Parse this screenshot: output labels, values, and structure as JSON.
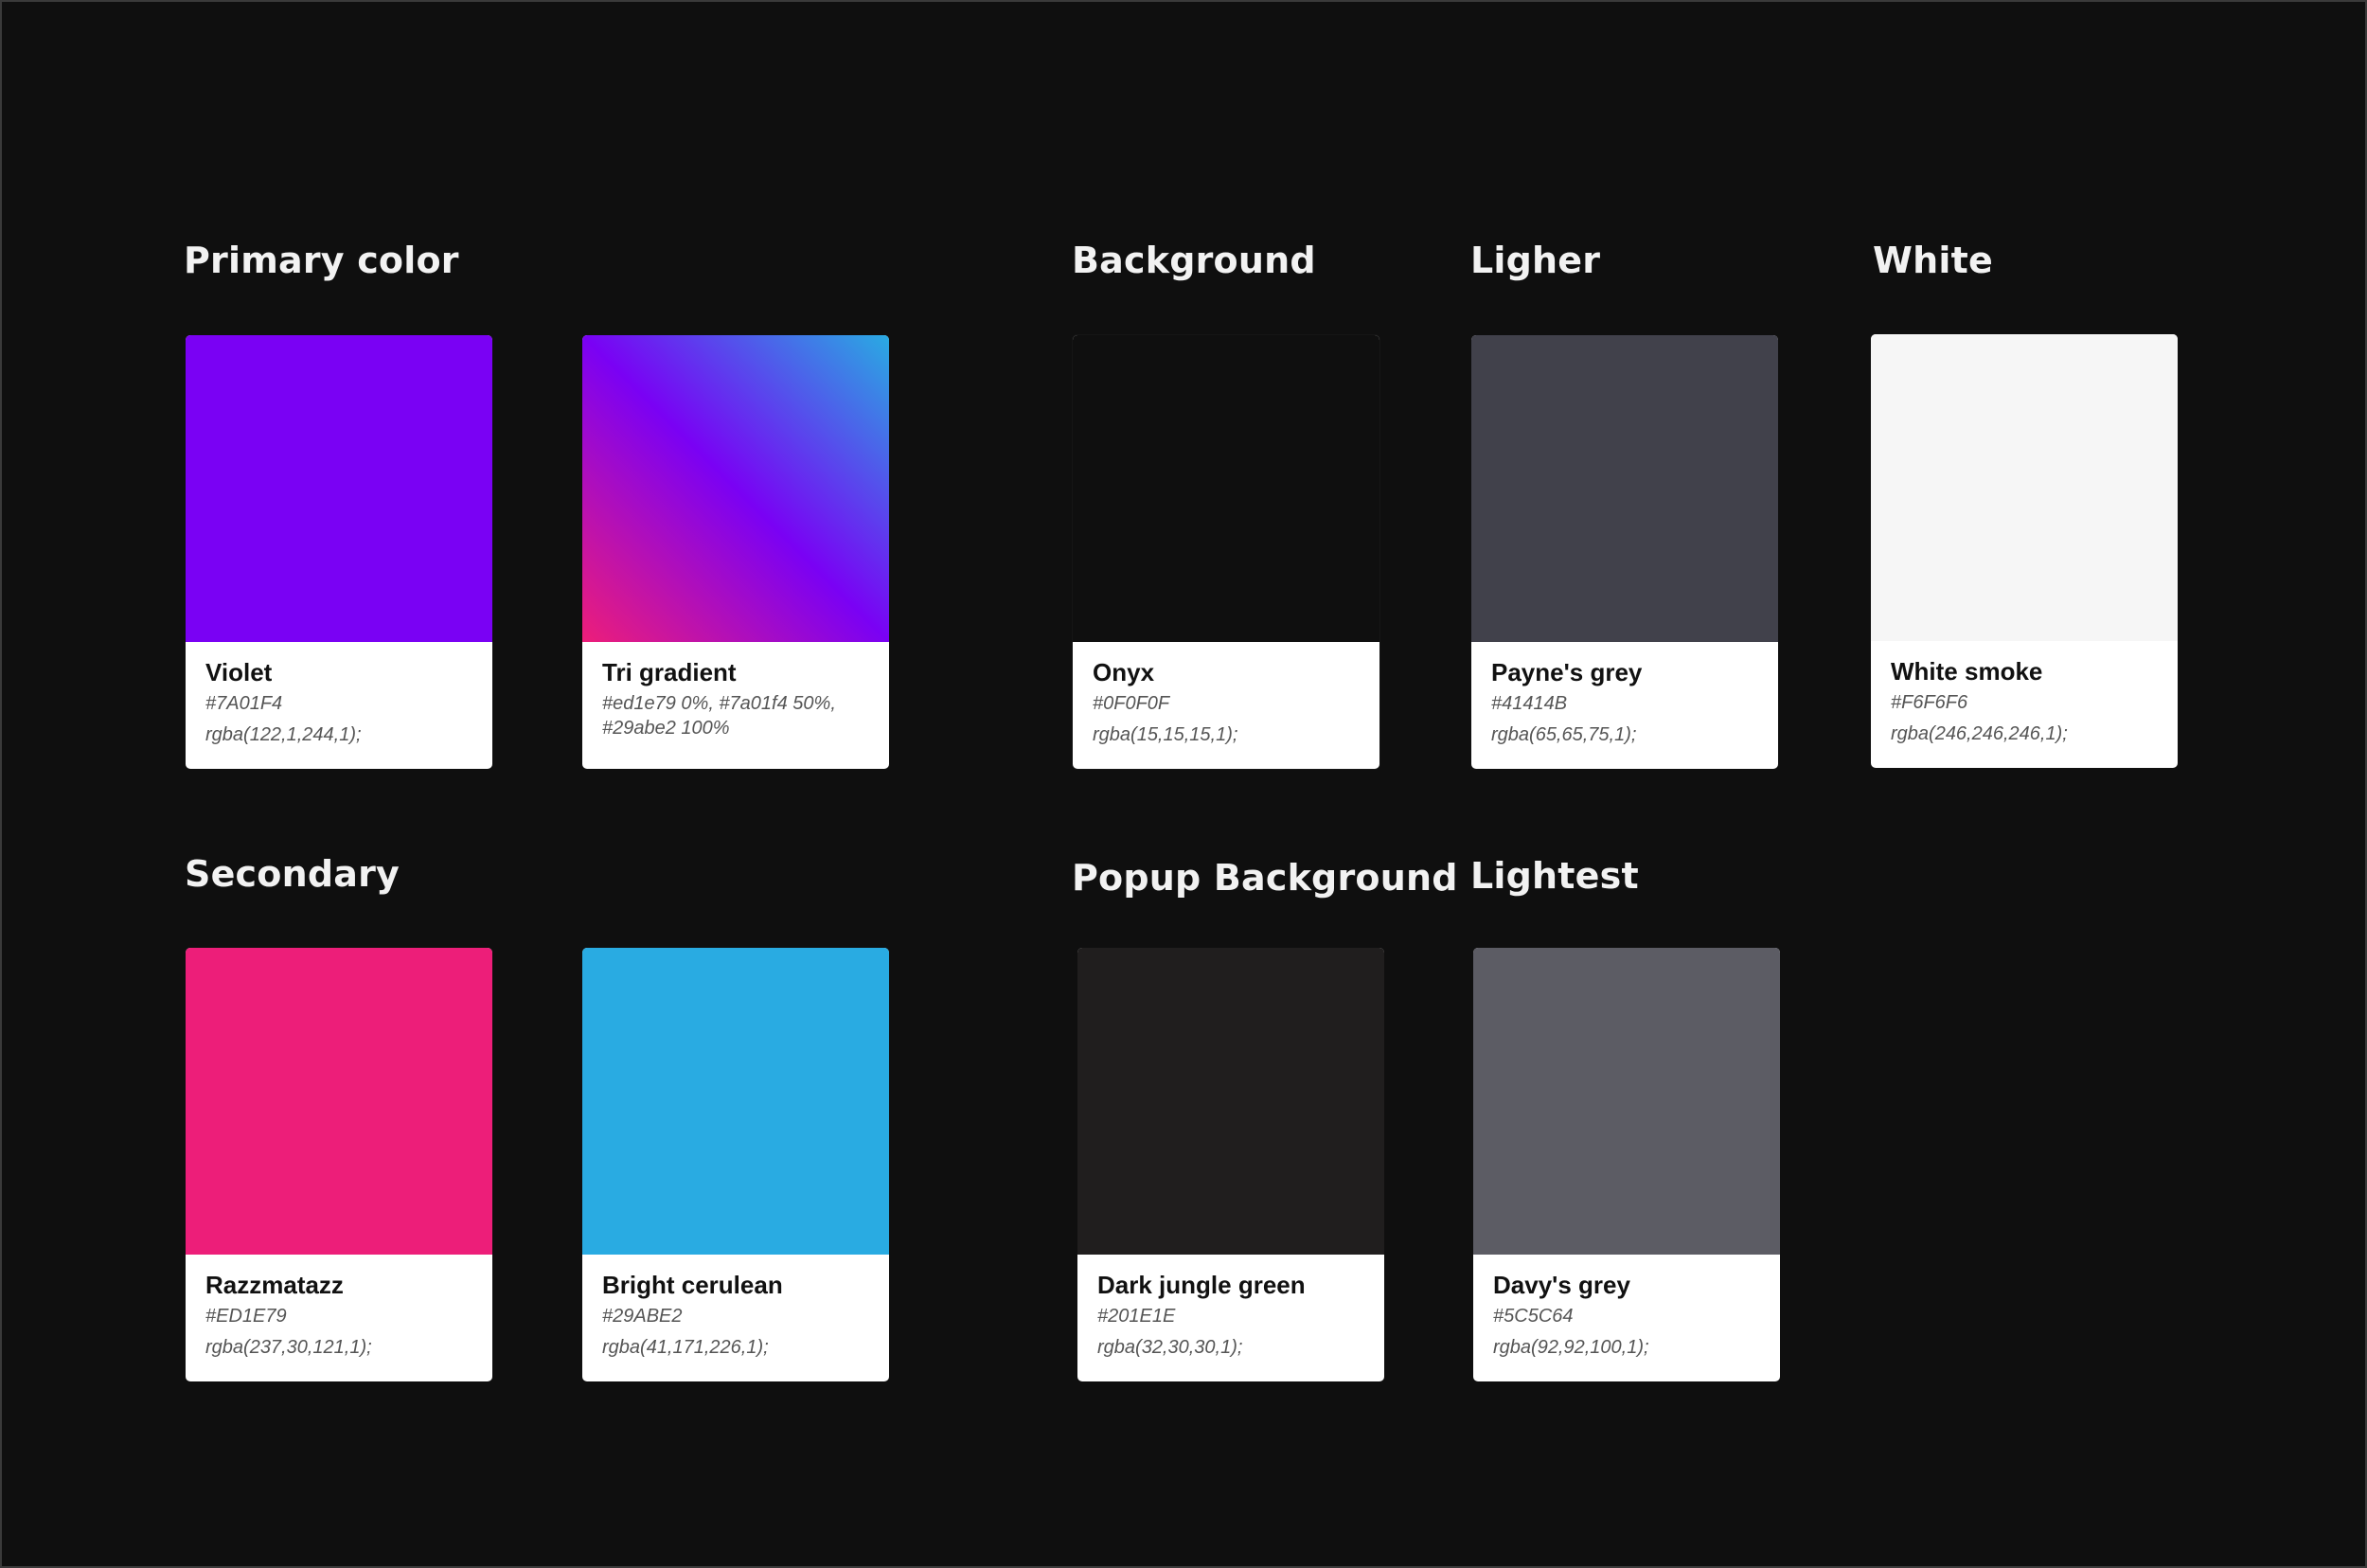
{
  "sections": {
    "primary": {
      "title": "Primary color"
    },
    "secondary": {
      "title": "Secondary"
    },
    "background": {
      "title": "Background"
    },
    "popup_background": {
      "title": "Popup Background"
    },
    "ligher": {
      "title": "Ligher"
    },
    "lightest": {
      "title": "Lightest"
    },
    "white": {
      "title": "White"
    }
  },
  "colors": {
    "violet": {
      "name": "Violet",
      "hex": "#7A01F4",
      "rgba": "rgba(122,1,244,1);",
      "swatch": "#7A01F4"
    },
    "tri_gradient": {
      "name": "Tri gradient",
      "description": " #ed1e79 0%, #7a01f4 50%, #29abe2 100%",
      "stops": [
        "#ed1e79",
        "#7a01f4",
        "#29abe2"
      ]
    },
    "razzmatazz": {
      "name": "Razzmatazz",
      "hex": "#ED1E79",
      "rgba": "rgba(237,30,121,1);",
      "swatch": "#ED1E79"
    },
    "bright_cerulean": {
      "name": "Bright cerulean",
      "hex": "#29ABE2",
      "rgba": "rgba(41,171,226,1);",
      "swatch": "#29ABE2"
    },
    "onyx": {
      "name": "Onyx",
      "hex": "#0F0F0F",
      "rgba": "rgba(15,15,15,1);",
      "swatch": "#0F0F0F"
    },
    "dark_jungle_green": {
      "name": "Dark jungle green",
      "hex": "#201E1E",
      "rgba": "rgba(32,30,30,1);",
      "swatch": "#201E1E"
    },
    "paynes_grey": {
      "name": "Payne's grey",
      "hex": "#41414B",
      "rgba": "rgba(65,65,75,1);",
      "swatch": "#41414B"
    },
    "davys_grey": {
      "name": "Davy's grey",
      "hex": "#5C5C64",
      "rgba": "rgba(92,92,100,1);",
      "swatch": "#5C5C64"
    },
    "white_smoke": {
      "name": "White smoke",
      "hex": "#F6F6F6",
      "rgba": "rgba(246,246,246,1);",
      "swatch": "#F6F6F6"
    }
  }
}
